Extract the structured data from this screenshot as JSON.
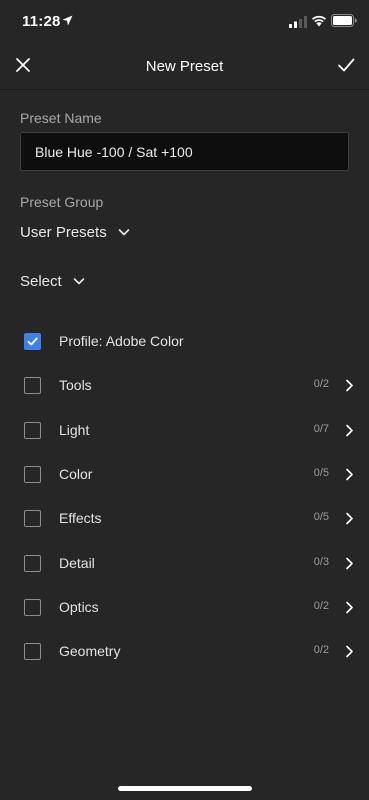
{
  "status_bar": {
    "time": "11:28",
    "icons": [
      "location-arrow-icon",
      "cellular-signal-icon",
      "wifi-icon",
      "battery-icon"
    ]
  },
  "nav": {
    "title": "New Preset",
    "close_icon": "close-icon",
    "confirm_icon": "checkmark-icon"
  },
  "preset_name": {
    "label": "Preset Name",
    "value": "Blue Hue -100 / Sat +100"
  },
  "preset_group": {
    "label": "Preset Group",
    "selected": "User Presets"
  },
  "select": {
    "label": "Select"
  },
  "settings": [
    {
      "label": "Profile: Adobe Color",
      "checked": true,
      "count": "",
      "has_chevron": false
    },
    {
      "label": "Tools",
      "checked": false,
      "count": "0/2",
      "has_chevron": true
    },
    {
      "label": "Light",
      "checked": false,
      "count": "0/7",
      "has_chevron": true
    },
    {
      "label": "Color",
      "checked": false,
      "count": "0/5",
      "has_chevron": true
    },
    {
      "label": "Effects",
      "checked": false,
      "count": "0/5",
      "has_chevron": true
    },
    {
      "label": "Detail",
      "checked": false,
      "count": "0/3",
      "has_chevron": true
    },
    {
      "label": "Optics",
      "checked": false,
      "count": "0/2",
      "has_chevron": true
    },
    {
      "label": "Geometry",
      "checked": false,
      "count": "0/2",
      "has_chevron": true
    }
  ],
  "colors": {
    "background": "#262626",
    "accent": "#3f80ea",
    "input_background": "#0e0e0e"
  }
}
